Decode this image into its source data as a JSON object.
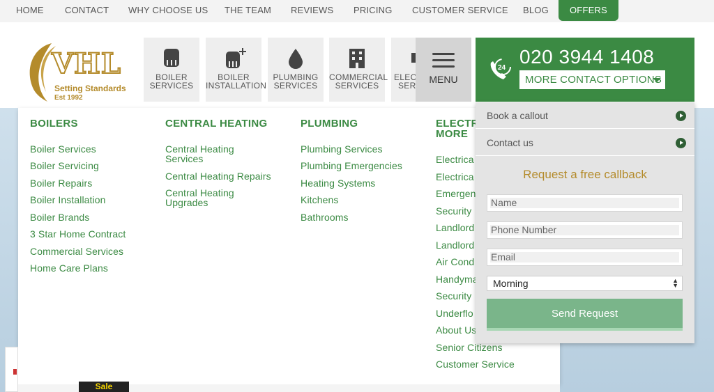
{
  "topnav": {
    "items": [
      "HOME",
      "CONTACT",
      "WHY CHOOSE US",
      "THE TEAM",
      "REVIEWS",
      "PRICING",
      "CUSTOMER SERVICE",
      "BLOG"
    ],
    "offers": "OFFERS"
  },
  "logo": {
    "name": "VHL",
    "tagline": "Setting Standards",
    "est": "Est 1992"
  },
  "tiles": [
    {
      "line1": "BOILER",
      "line2": "SERVICES",
      "icon": "boiler-icon"
    },
    {
      "line1": "BOILER",
      "line2": "INSTALLATION",
      "icon": "boiler-add-icon"
    },
    {
      "line1": "PLUMBING",
      "line2": "SERVICES",
      "icon": "water-drop-icon"
    },
    {
      "line1": "COMMERCIAL",
      "line2": "SERVICES",
      "icon": "building-icon"
    },
    {
      "line1": "ELECT",
      "line2": "SERV",
      "icon": "electrical-icon"
    }
  ],
  "menu_label": "MENU",
  "contact": {
    "phone": "020 3944 1408",
    "more": "MORE CONTACT OPTIONS",
    "badge": "24"
  },
  "mega": {
    "boilers": {
      "title": "BOILERS",
      "links": [
        "Boiler Services",
        "Boiler Servicing",
        "Boiler Repairs",
        "Boiler Installation",
        "Boiler Brands",
        "3 Star Home Contract",
        "Commercial Services",
        "Home Care Plans"
      ]
    },
    "heating": {
      "title": "CENTRAL HEATING",
      "links": [
        "Central Heating",
        "Services",
        "Central Heating Repairs",
        "Central Heating",
        "Upgrades"
      ]
    },
    "plumbing": {
      "title": "PLUMBING",
      "links": [
        "Plumbing Services",
        "Plumbing Emergencies",
        "Heating Systems",
        "Kitchens",
        "Bathrooms"
      ]
    },
    "electrical": {
      "title1": "ELECTR",
      "title2": "MORE",
      "links": [
        "Electrica",
        "Electrica",
        "Emergen",
        "Security",
        "Landlord",
        "Landlord",
        "Air Cond",
        "Handyma",
        "Security",
        "Underflo",
        "About Us",
        "Senior Citizens",
        "Customer Service"
      ]
    }
  },
  "side": {
    "book": "Book a callout",
    "contact_us": "Contact us",
    "title": "Request a free callback",
    "name_ph": "Name",
    "phone_ph": "Phone Number",
    "email_ph": "Email",
    "time": "Morning",
    "send": "Send Request"
  },
  "sale": "Sale",
  "colors": {
    "brand_green": "#3b8a43",
    "gold": "#b48b2b"
  }
}
